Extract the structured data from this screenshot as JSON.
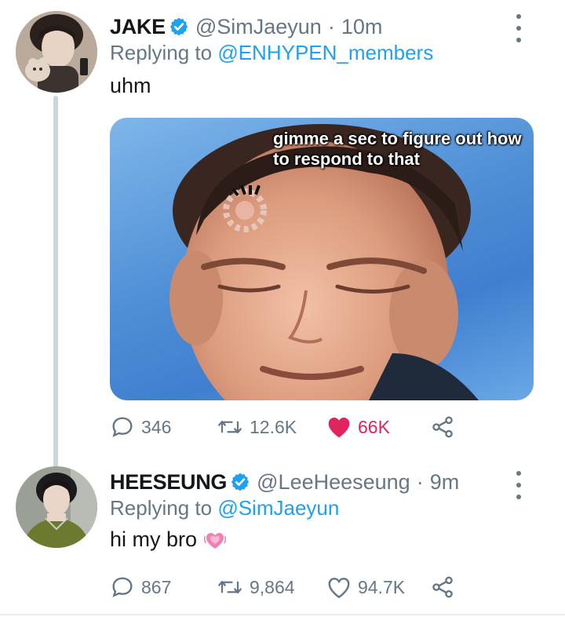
{
  "tweets": [
    {
      "display_name": "JAKE",
      "handle": "@SimJaeyun",
      "separator": "·",
      "time": "10m",
      "replying_label": "Replying to",
      "replying_to": "@ENHYPEN_members",
      "text": "uhm",
      "media_caption": "gimme a sec to figure out how to respond to that",
      "stats": {
        "replies": "346",
        "retweets": "12.6K",
        "likes": "66K"
      },
      "liked": true
    },
    {
      "display_name": "HEESEUNG",
      "handle": "@LeeHeeseung",
      "separator": "·",
      "time": "9m",
      "replying_label": "Replying to",
      "replying_to": "@SimJaeyun",
      "text": "hi my bro",
      "emoji": "growing-heart",
      "stats": {
        "replies": "867",
        "retweets": "9,864",
        "likes": "94.7K"
      },
      "liked": false
    }
  ],
  "colors": {
    "link": "#1da1f2",
    "secondary_text": "#657786",
    "like_active": "#e0245e",
    "verified": "#1da1f2"
  },
  "icons": [
    "verified-badge-icon",
    "more-vertical-icon",
    "reply-icon",
    "retweet-icon",
    "like-icon",
    "share-icon",
    "loading-spinner-icon",
    "growing-heart-emoji"
  ]
}
